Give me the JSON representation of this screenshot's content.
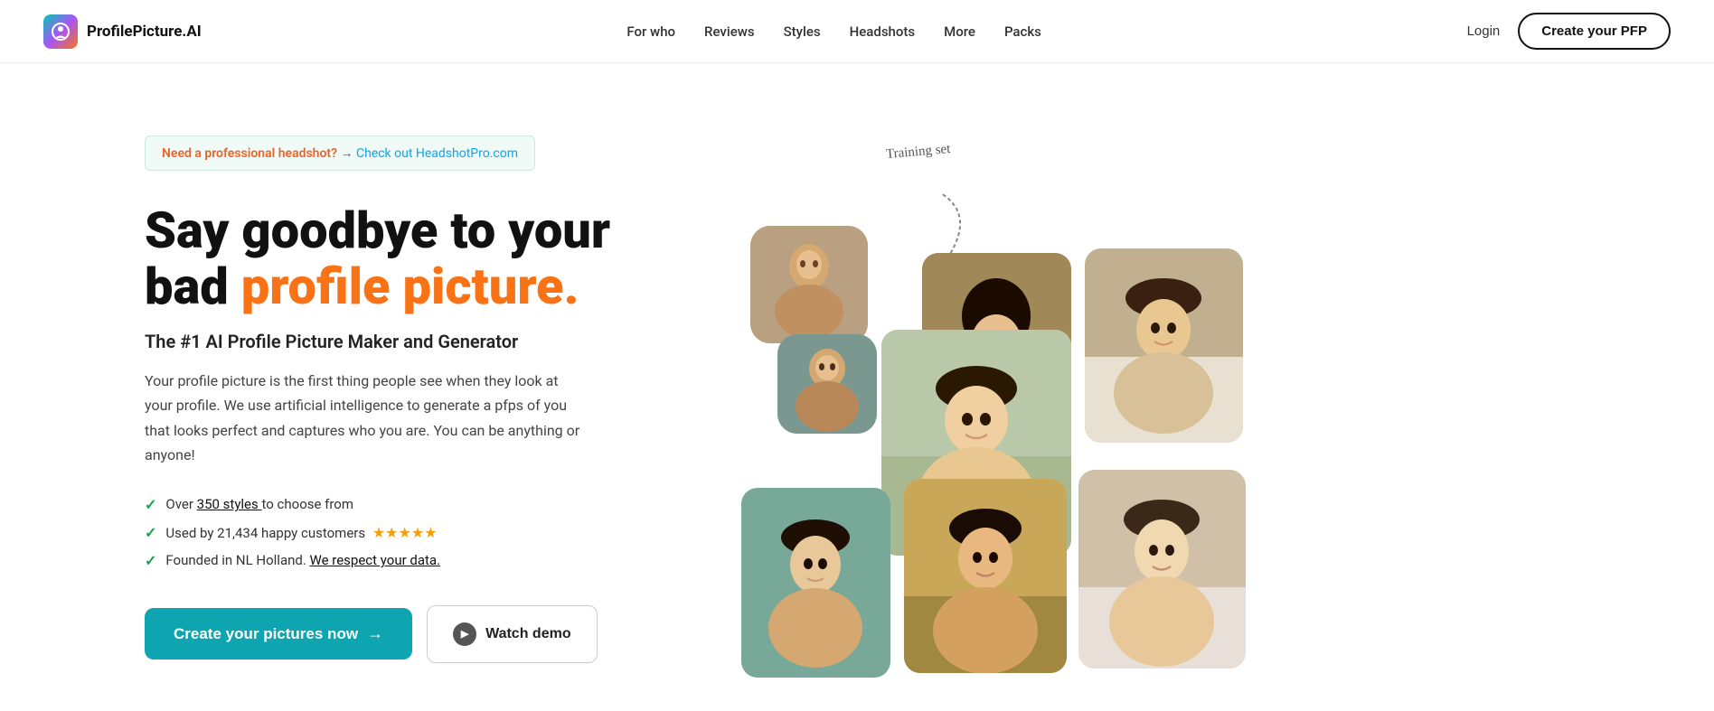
{
  "nav": {
    "logo_text": "ProfilePicture.AI",
    "links": [
      {
        "label": "For who",
        "id": "for-who"
      },
      {
        "label": "Reviews",
        "id": "reviews"
      },
      {
        "label": "Styles",
        "id": "styles"
      },
      {
        "label": "Headshots",
        "id": "headshots"
      },
      {
        "label": "More",
        "id": "more"
      },
      {
        "label": "Packs",
        "id": "packs"
      }
    ],
    "login_label": "Login",
    "create_pfp_label": "Create your PFP"
  },
  "banner": {
    "highlight_text": "Need a professional headshot?",
    "separator": "→",
    "link_text": "Check out HeadshotPro.com"
  },
  "hero": {
    "heading_line1": "Say goodbye to your",
    "heading_line2_plain": "bad ",
    "heading_line2_highlight": "profile picture.",
    "subtitle": "The #1 AI Profile Picture Maker and Generator",
    "description": "Your profile picture is the first thing people see when they look at your profile. We use artificial intelligence to generate a pfps of you that looks perfect and captures who you are. You can be anything or anyone!",
    "checklist": [
      {
        "text_prefix": "Over ",
        "link_text": "350 styles ",
        "text_suffix": "to choose from"
      },
      {
        "text_prefix": "Used by 21,434 happy customers",
        "stars": "★★★★★"
      },
      {
        "text_prefix": "Founded in NL Holland. ",
        "link_text": "We respect your data."
      }
    ],
    "cta_button": "Create your pictures now",
    "watch_demo": "Watch demo",
    "training_label": "Training set"
  },
  "colors": {
    "accent_orange": "#f97316",
    "accent_teal": "#0ea5b0",
    "check_green": "#16a34a",
    "star_yellow": "#f59e0b",
    "banner_orange": "#e8642a"
  }
}
